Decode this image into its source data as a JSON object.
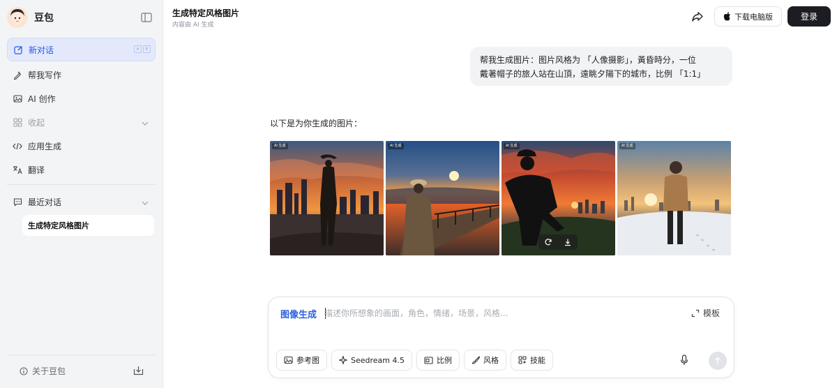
{
  "sidebar": {
    "brand_name": "豆包",
    "items": [
      {
        "label": "新对话",
        "icon": "edit-icon"
      },
      {
        "label": "帮我写作",
        "icon": "pen-icon"
      },
      {
        "label": "AI 创作",
        "icon": "image-icon"
      },
      {
        "label": "收起",
        "icon": "apps-icon"
      },
      {
        "label": "应用生成",
        "icon": "code-icon"
      },
      {
        "label": "翻译",
        "icon": "translate-icon"
      }
    ],
    "shortcut_keys": [
      "⌘",
      "K"
    ],
    "recent_label": "最近对话",
    "recent_chats": [
      "生成特定风格图片"
    ],
    "about_label": "关于豆包"
  },
  "header": {
    "title": "生成特定风格图片",
    "subtitle": "内容由 AI 生成",
    "download_label": "下载电脑版",
    "login_label": "登录"
  },
  "conversation": {
    "user_message_lines": [
      "帮我生成图片：图片风格为 「人像摄影」，黃昏時分，一位",
      "戴著帽子的旅人站在山頂，遠眺夕陽下的城市，比例 「1:1」"
    ],
    "bot_intro": "以下是为你生成的图片：",
    "image_tag": "AI 生成",
    "images": [
      {
        "scene": "traveler-hat-city-sunset"
      },
      {
        "scene": "traveler-boardwalk-sunset"
      },
      {
        "scene": "hooded-man-city-dusk"
      },
      {
        "scene": "traveler-snow-sunset"
      }
    ]
  },
  "composer": {
    "mode_label": "图像生成",
    "placeholder": "描述你所想象的画面，角色，情绪，场景，风格...",
    "template_label": "模板",
    "tools": [
      {
        "label": "参考图",
        "icon": "reference-image-icon"
      },
      {
        "label": "Seedream 4.5",
        "icon": "sparkle-icon"
      },
      {
        "label": "比例",
        "icon": "aspect-ratio-icon"
      },
      {
        "label": "风格",
        "icon": "brush-icon"
      },
      {
        "label": "技能",
        "icon": "skills-icon"
      }
    ]
  },
  "colors": {
    "accent": "#2757e6",
    "sidebar_bg": "#f3f4f6",
    "login_bg": "#1c1d22"
  }
}
